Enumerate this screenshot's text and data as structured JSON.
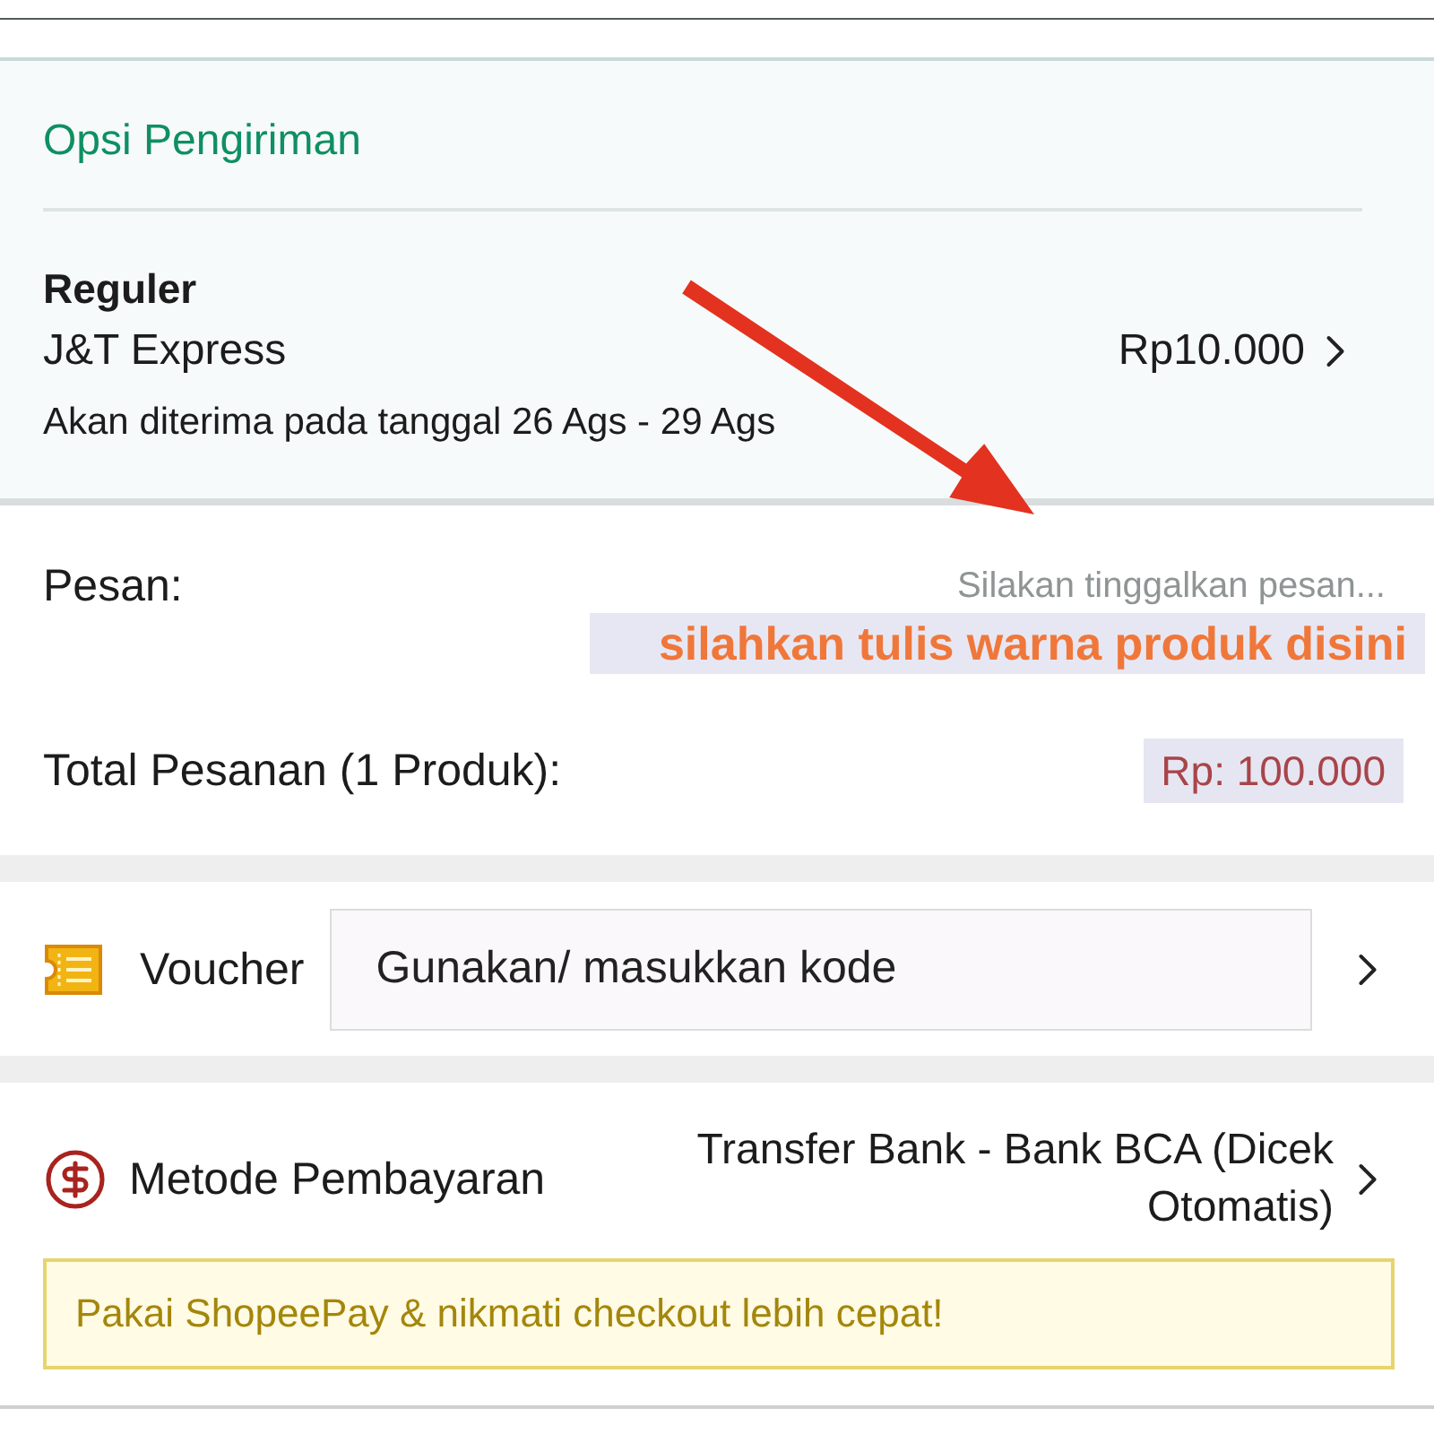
{
  "shipping": {
    "title": "Opsi Pengiriman",
    "service": "Reguler",
    "courier": "J&T Express",
    "estimate": "Akan diterima pada tanggal 26 Ags - 29 Ags",
    "price": "Rp10.000"
  },
  "message": {
    "label": "Pesan:",
    "placeholder": "Silakan tinggalkan pesan...",
    "annotation": "silahkan tulis warna produk disini"
  },
  "total": {
    "label": "Total Pesanan (1 Produk):",
    "amount": "Rp: 100.000"
  },
  "voucher": {
    "label": "Voucher",
    "placeholder": "Gunakan/ masukkan kode"
  },
  "payment": {
    "label": "Metode Pembayaran",
    "method": "Transfer Bank - Bank BCA (Dicek Otomatis)",
    "promo": "Pakai ShopeePay & nikmati checkout lebih cepat!"
  }
}
